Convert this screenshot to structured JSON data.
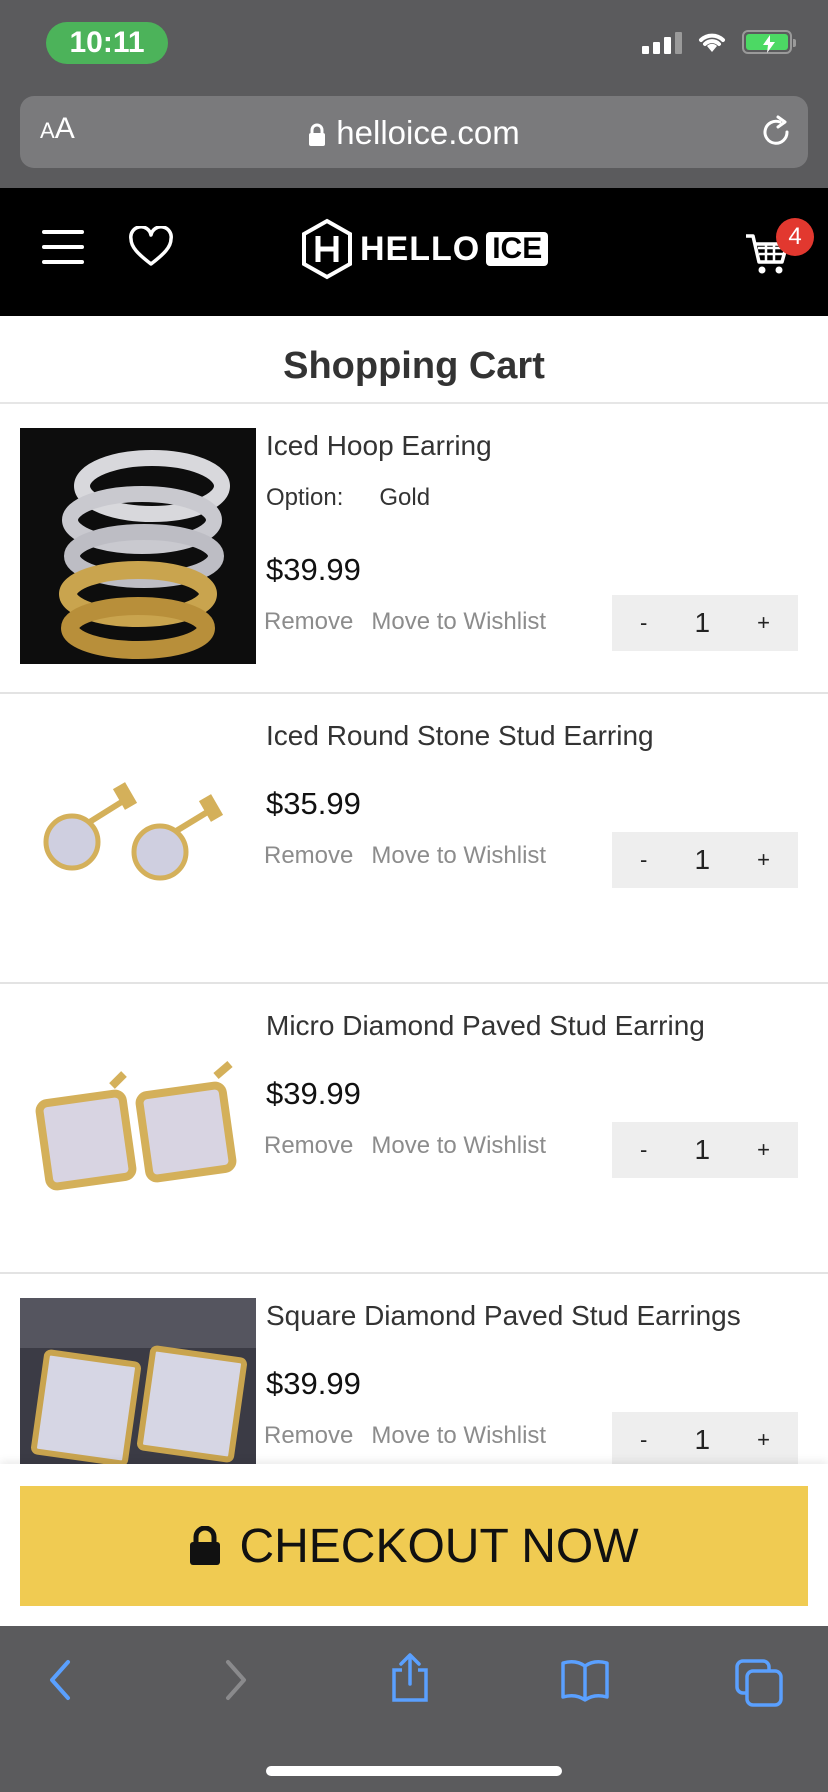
{
  "status_bar": {
    "time": "10:11"
  },
  "browser": {
    "text_size_label": "AA",
    "url": "helloice.com"
  },
  "header": {
    "logo_text": "HELLO",
    "logo_text_box": "ICE",
    "cart_count": "4"
  },
  "page_title": "Shopping Cart",
  "cart_items": [
    {
      "name": "Iced Hoop Earring",
      "option_label": "Option:",
      "option_value": "Gold",
      "price": "$39.99",
      "remove": "Remove",
      "wishlist": "Move to Wishlist",
      "qty_minus": "-",
      "quantity": "1",
      "qty_plus": "+"
    },
    {
      "name": "Iced Round Stone Stud Earring",
      "price": "$35.99",
      "remove": "Remove",
      "wishlist": "Move to Wishlist",
      "qty_minus": "-",
      "quantity": "1",
      "qty_plus": "+"
    },
    {
      "name": "Micro Diamond Paved Stud Earring",
      "price": "$39.99",
      "remove": "Remove",
      "wishlist": "Move to Wishlist",
      "qty_minus": "-",
      "quantity": "1",
      "qty_plus": "+"
    },
    {
      "name": "Square Diamond Paved Stud Earrings",
      "price": "$39.99",
      "remove": "Remove",
      "wishlist": "Move to Wishlist",
      "qty_minus": "-",
      "quantity": "1",
      "qty_plus": "+"
    }
  ],
  "checkout": {
    "label": "CHECKOUT NOW"
  },
  "colors": {
    "checkout_bg": "#f0cb52",
    "badge": "#e2382f",
    "header_bg": "#000000"
  },
  "toolbar_icons": [
    "back-icon",
    "forward-icon",
    "share-icon",
    "bookmarks-icon",
    "tabs-icon"
  ]
}
